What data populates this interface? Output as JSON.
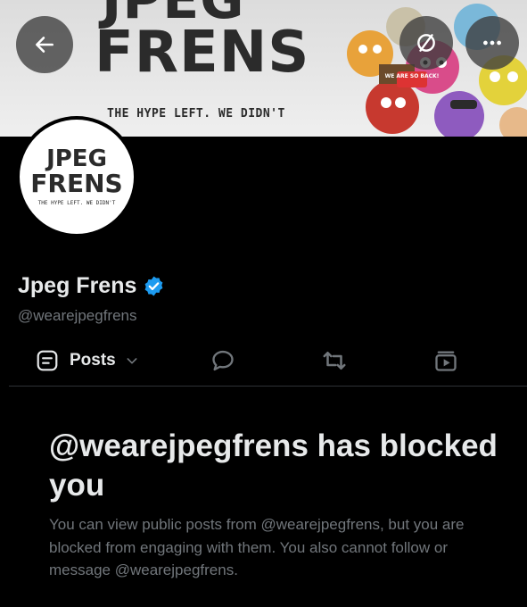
{
  "banner": {
    "title_line1": "JPEG",
    "title_line2": "FRENS",
    "tagline": "THE HYPE LEFT. WE DIDN'T",
    "collage_sign": "WE ARE SO BACK!"
  },
  "avatar": {
    "line1": "JPEG",
    "line2": "FRENS",
    "tagline": "THE HYPE LEFT. WE DIDN'T"
  },
  "profile": {
    "display_name": "Jpeg Frens",
    "verified": true,
    "handle": "@wearejpegfrens"
  },
  "tabs": {
    "posts_label": "Posts"
  },
  "blocked": {
    "title": "@wearejpegfrens has blocked you",
    "description": "You can view public posts from @wearejpegfrens, but you are blocked from engaging with them. You also cannot follow or message @wearejpegfrens."
  },
  "colors": {
    "background": "#000000",
    "text_primary": "#e7e9ea",
    "text_secondary": "#71767b",
    "verified_blue": "#1d9bf0"
  },
  "icons": {
    "back": "arrow-left-icon",
    "top_action": "slashed-circle-icon",
    "more": "more-dots-icon",
    "verified": "verified-badge-icon",
    "posts": "posts-list-icon",
    "dropdown": "chevron-down-icon",
    "replies": "speech-bubble-icon",
    "reposts": "repost-icon",
    "media": "media-play-icon"
  }
}
